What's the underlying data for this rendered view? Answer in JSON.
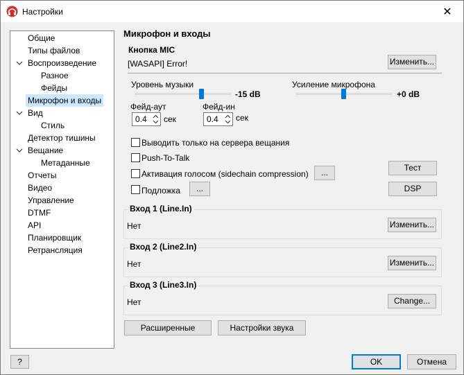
{
  "window": {
    "title": "Настройки",
    "close_glyph": "✕",
    "icon": "headphones-app-icon"
  },
  "tree": {
    "items": [
      {
        "label": "Общие"
      },
      {
        "label": "Типы файлов"
      },
      {
        "label": "Воспроизведение",
        "expanded": true
      },
      {
        "label": "Разное"
      },
      {
        "label": "Фейды"
      },
      {
        "label": "Микрофон и входы",
        "selected": true
      },
      {
        "label": "Вид",
        "expanded": true
      },
      {
        "label": "Стиль"
      },
      {
        "label": "Детектор тишины"
      },
      {
        "label": "Вещание",
        "expanded": true
      },
      {
        "label": "Метаданные"
      },
      {
        "label": "Отчеты"
      },
      {
        "label": "Видео"
      },
      {
        "label": "Управление"
      },
      {
        "label": "DTMF"
      },
      {
        "label": "API"
      },
      {
        "label": "Планировщик"
      },
      {
        "label": "Ретрансляция"
      }
    ]
  },
  "main": {
    "title": "Микрофон и входы",
    "mic": {
      "group_label": "Кнопка MIC",
      "status": "[WASAPI] Error!",
      "change_label": "Изменить...",
      "music_level_label": "Уровень музыки",
      "music_level_value": "-15 dB",
      "mic_gain_label": "Усиление микрофона",
      "mic_gain_value": "+0 dB",
      "fade_out_label": "Фейд-аут",
      "fade_out_value": "0.4",
      "fade_in_label": "Фейд-ин",
      "fade_in_value": "0.4",
      "sec_label": "сек",
      "checkboxes": {
        "broadcast_only": {
          "label": "Выводить только на сервера вещания",
          "checked": false
        },
        "push_to_talk": {
          "label": "Push-To-Talk",
          "checked": false
        },
        "voice_activation": {
          "label": "Активация голосом (sidechain compression)",
          "checked": false
        },
        "background": {
          "label": "Подложка",
          "checked": false
        }
      },
      "ellipsis_label": "...",
      "test_label": "Тест",
      "dsp_label": "DSP"
    },
    "inputs": [
      {
        "label": "Вход 1 (Line.In)",
        "value": "Нет",
        "button": "Изменить..."
      },
      {
        "label": "Вход 2 (Line2.In)",
        "value": "Нет",
        "button": "Изменить..."
      },
      {
        "label": "Вход 3 (Line3.In)",
        "value": "Нет",
        "button": "Change..."
      }
    ],
    "advanced_label": "Расширенные",
    "sound_settings_label": "Настройки звука"
  },
  "footer": {
    "help_label": "?",
    "ok_label": "OK",
    "cancel_label": "Отмена"
  }
}
